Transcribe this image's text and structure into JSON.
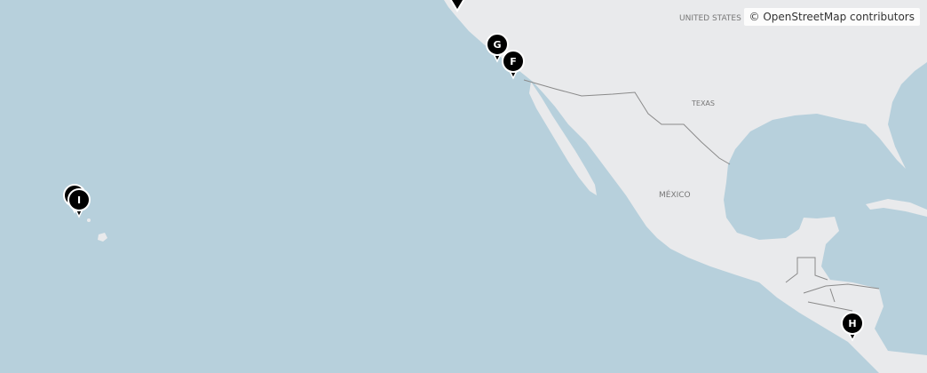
{
  "attribution": "© OpenStreetMap contributors",
  "labels": {
    "usa": "UNITED STATES",
    "texas": "TEXAS",
    "mexico": "MÉXICO"
  },
  "markers": [
    {
      "id": "G",
      "label": "G"
    },
    {
      "id": "F",
      "label": "F"
    },
    {
      "id": "I",
      "label": "I"
    },
    {
      "id": "H",
      "label": "H"
    },
    {
      "id": "top",
      "label": ""
    },
    {
      "id": "hawaii-2",
      "label": ""
    }
  ],
  "colors": {
    "ocean": "#b7d0dc",
    "land": "#e9eaec",
    "border": "#8a8a8a",
    "marker": "#000000",
    "marker_text": "#ffffff"
  }
}
